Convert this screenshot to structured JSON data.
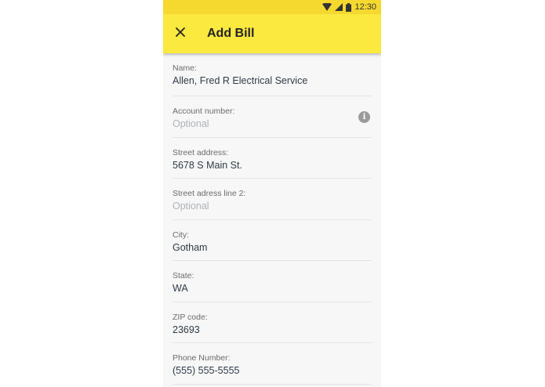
{
  "status_bar": {
    "time": "12:30"
  },
  "toolbar": {
    "title": "Add Bill"
  },
  "form": {
    "name": {
      "label": "Name:",
      "value": "Allen, Fred R Electrical Service",
      "placeholder": ""
    },
    "account_number": {
      "label": "Account number:",
      "value": "",
      "placeholder": "Optional"
    },
    "street_address": {
      "label": "Street address:",
      "value": "5678 S Main St.",
      "placeholder": ""
    },
    "street_address_2": {
      "label": "Street adress line 2:",
      "value": "",
      "placeholder": "Optional"
    },
    "city": {
      "label": "City:",
      "value": "Gotham",
      "placeholder": ""
    },
    "state": {
      "label": "State:",
      "value": "WA",
      "placeholder": ""
    },
    "zip": {
      "label": "ZIP code:",
      "value": "23693",
      "placeholder": ""
    },
    "phone": {
      "label": "Phone Number:",
      "value": "(555) 555-5555",
      "placeholder": ""
    }
  },
  "icons": {
    "close": "close-icon",
    "info": "info-icon",
    "wifi": "wifi-icon",
    "signal": "signal-icon",
    "battery": "battery-icon"
  },
  "colors": {
    "status_bar": "#f6d92f",
    "toolbar": "#fbe93f",
    "background": "#f7f7f7"
  }
}
